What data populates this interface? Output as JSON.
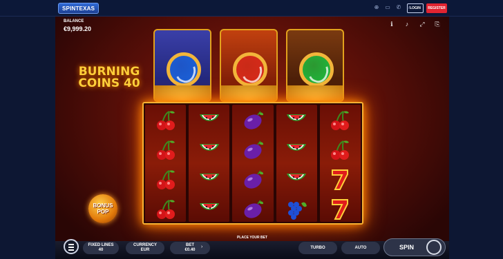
{
  "topbar": {
    "logo_text": "SPINTEXAS",
    "icons": [
      "language-icon",
      "chat-icon",
      "phone-icon",
      "search-icon"
    ],
    "login_label": "LOGIN",
    "register_label": "REGISTER"
  },
  "game": {
    "balance_label": "BALANCE",
    "balance_value": "€9,999.20",
    "title_line1": "BURNING",
    "title_line2": "COINS 40",
    "bonus_line1": "BONUS",
    "bonus_line2": "POP",
    "coins": [
      {
        "color": "#1b5fd6",
        "name": "blue"
      },
      {
        "color": "#d62a1a",
        "name": "red"
      },
      {
        "color": "#21b33a",
        "name": "green"
      }
    ],
    "reels": [
      [
        "cherry",
        "cherry",
        "cherry",
        "cherry"
      ],
      [
        "watermelon",
        "watermelon",
        "watermelon",
        "watermelon"
      ],
      [
        "plum",
        "plum",
        "plum",
        "plum"
      ],
      [
        "watermelon",
        "watermelon",
        "watermelon",
        "grapes"
      ],
      [
        "cherry",
        "cherry",
        "seven",
        "seven"
      ]
    ]
  },
  "controls": {
    "place_bet": "PLACE YOUR BET",
    "fixed_lines_label": "FIXED LINES",
    "fixed_lines_value": "40",
    "currency_label": "CURRENCY",
    "currency_value": "EUR",
    "bet_label": "BET",
    "bet_value": "€0.40",
    "turbo_label": "TURBO",
    "auto_label": "AUTO",
    "spin_label": "SPIN"
  }
}
